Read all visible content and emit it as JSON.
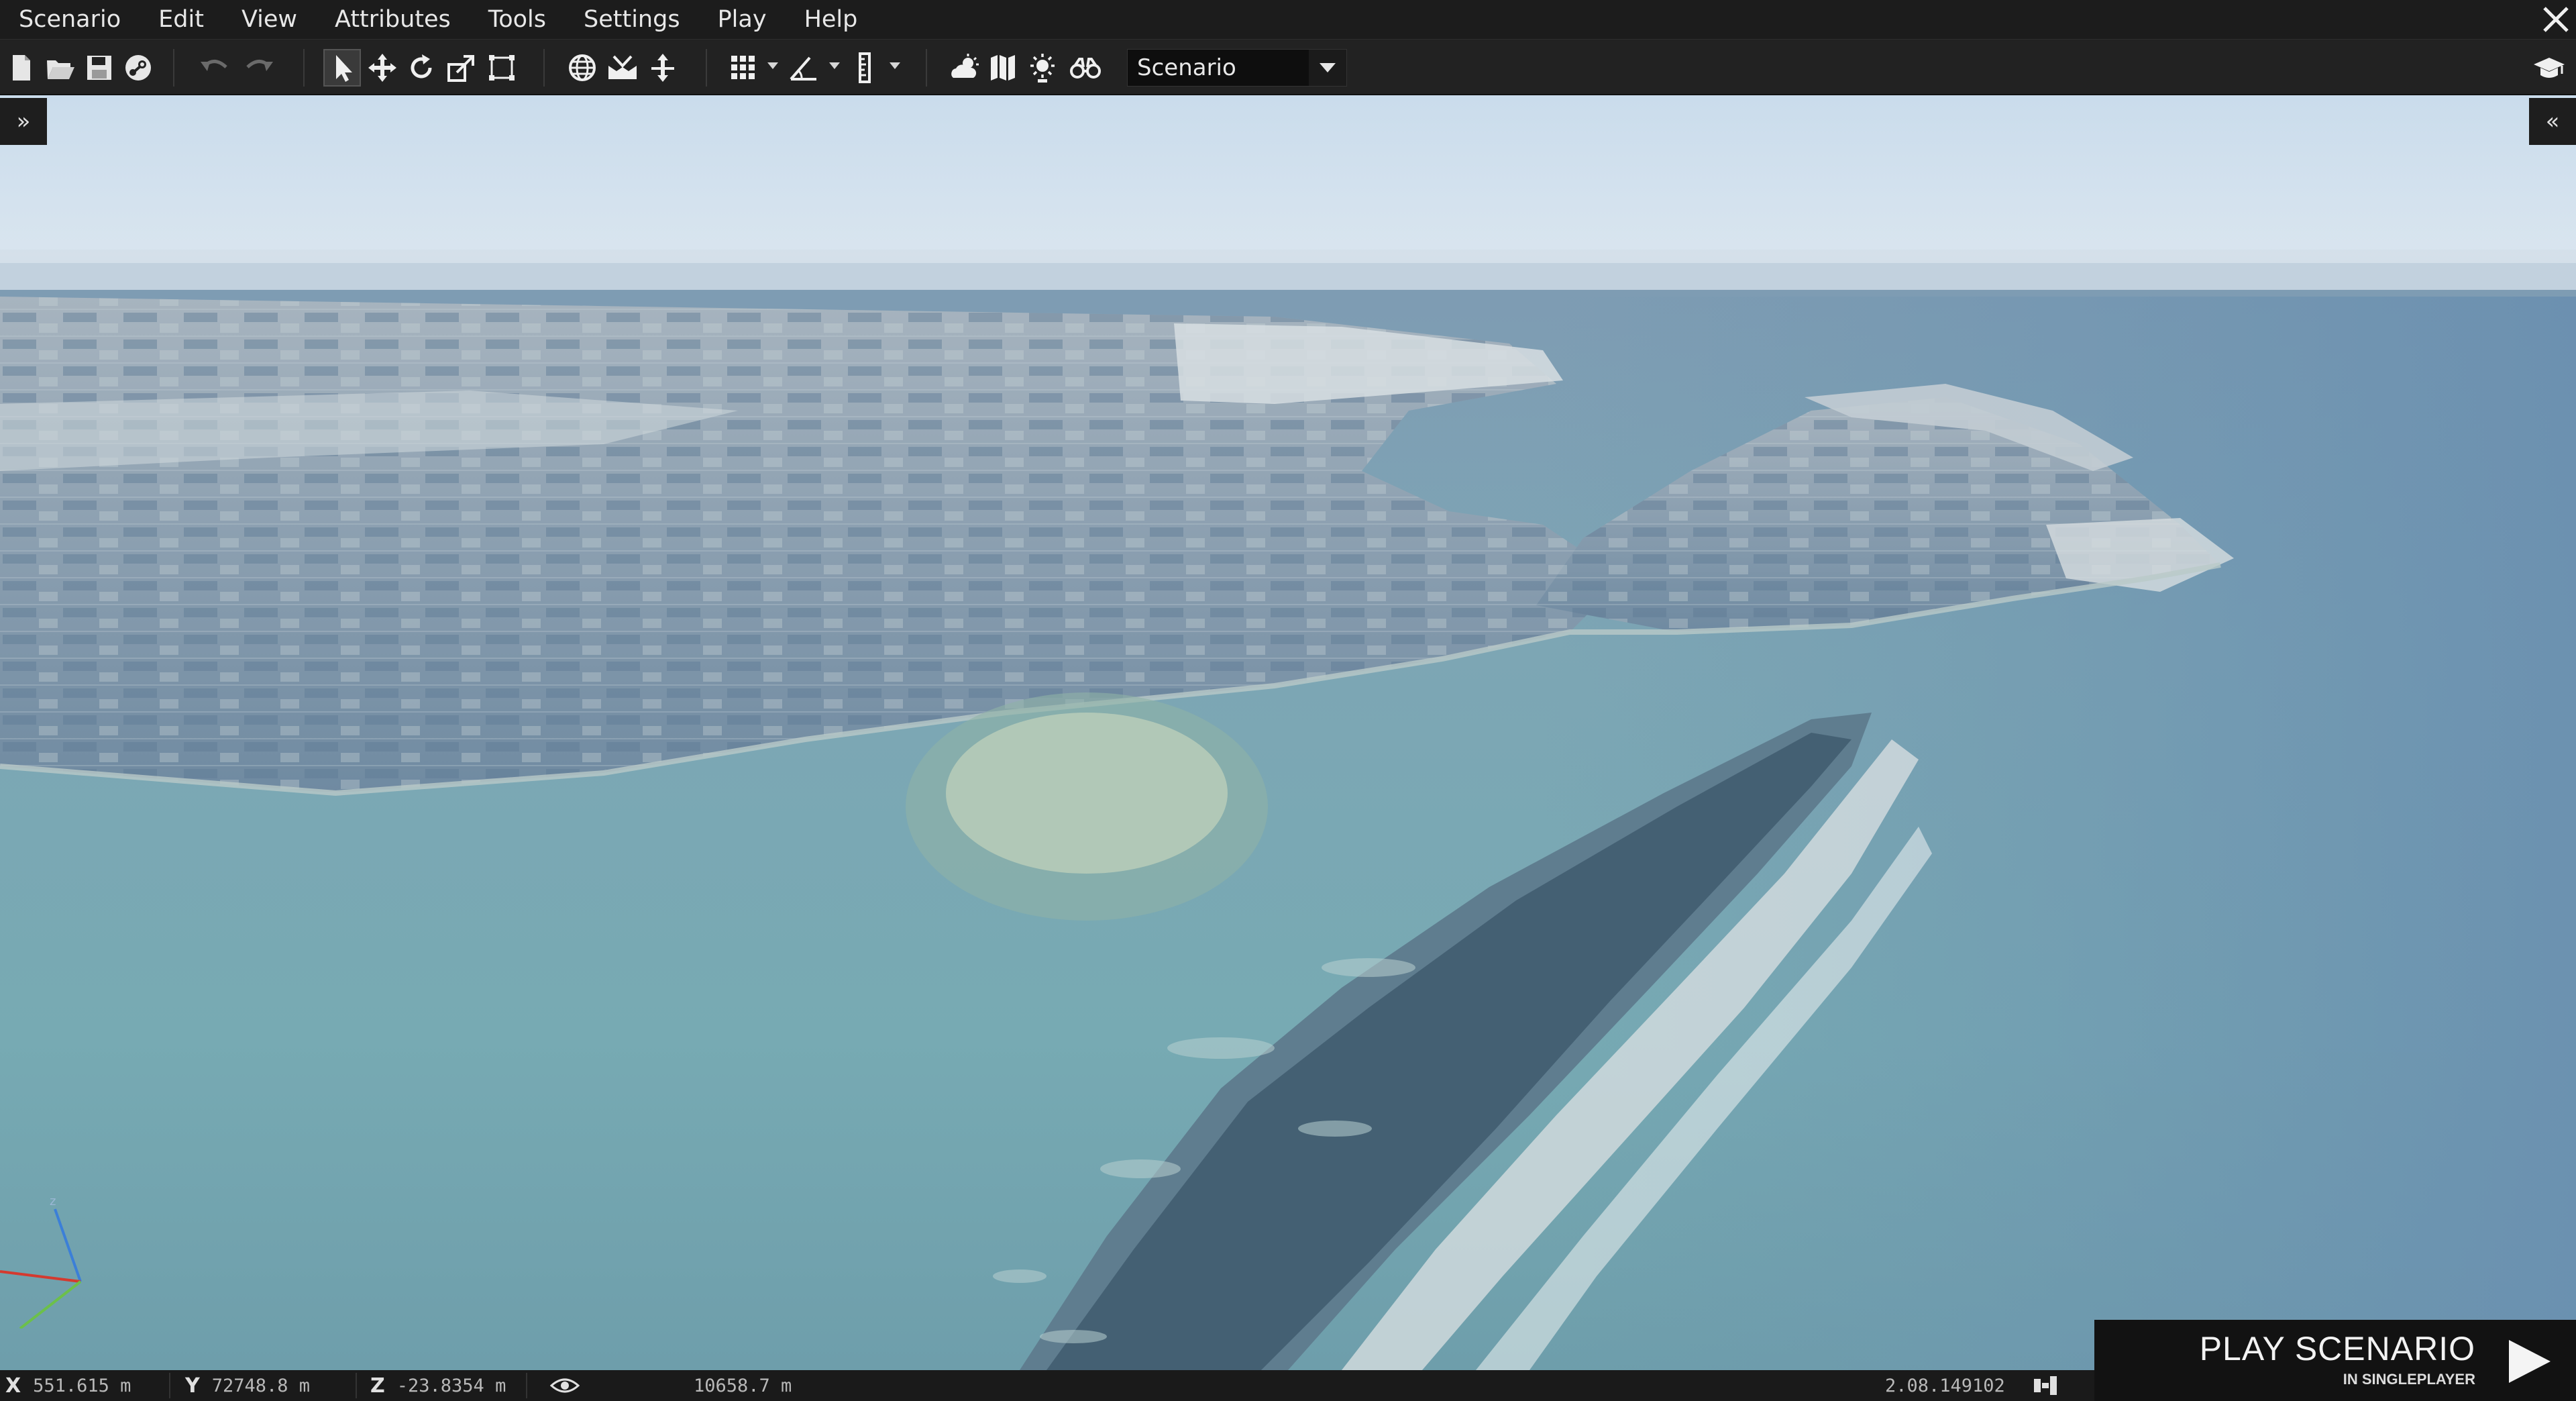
{
  "menu": [
    "Scenario",
    "Edit",
    "View",
    "Attributes",
    "Tools",
    "Settings",
    "Play",
    "Help"
  ],
  "toolbar": {
    "mode_value": "Scenario"
  },
  "side_tabs": {
    "left": "»",
    "right": "«"
  },
  "status": {
    "x_label": "X",
    "x_value": "551.615 m",
    "y_label": "Y",
    "y_value": "72748.8 m",
    "z_label": "Z",
    "z_value": "-23.8354 m",
    "view_distance": "10658.7 m",
    "version": "2.08.149102"
  },
  "play": {
    "title": "PLAY SCENARIO",
    "subtitle": "IN SINGLEPLAYER"
  },
  "gizmo": {
    "z_label": "z"
  },
  "colors": {
    "menu_bg": "#1c1c1c",
    "toolbar_bg": "#222222",
    "status_bg": "#1a1a1a",
    "axis_x": "#d43a2f",
    "axis_y": "#6cc04a",
    "axis_z": "#3b7fd8"
  }
}
